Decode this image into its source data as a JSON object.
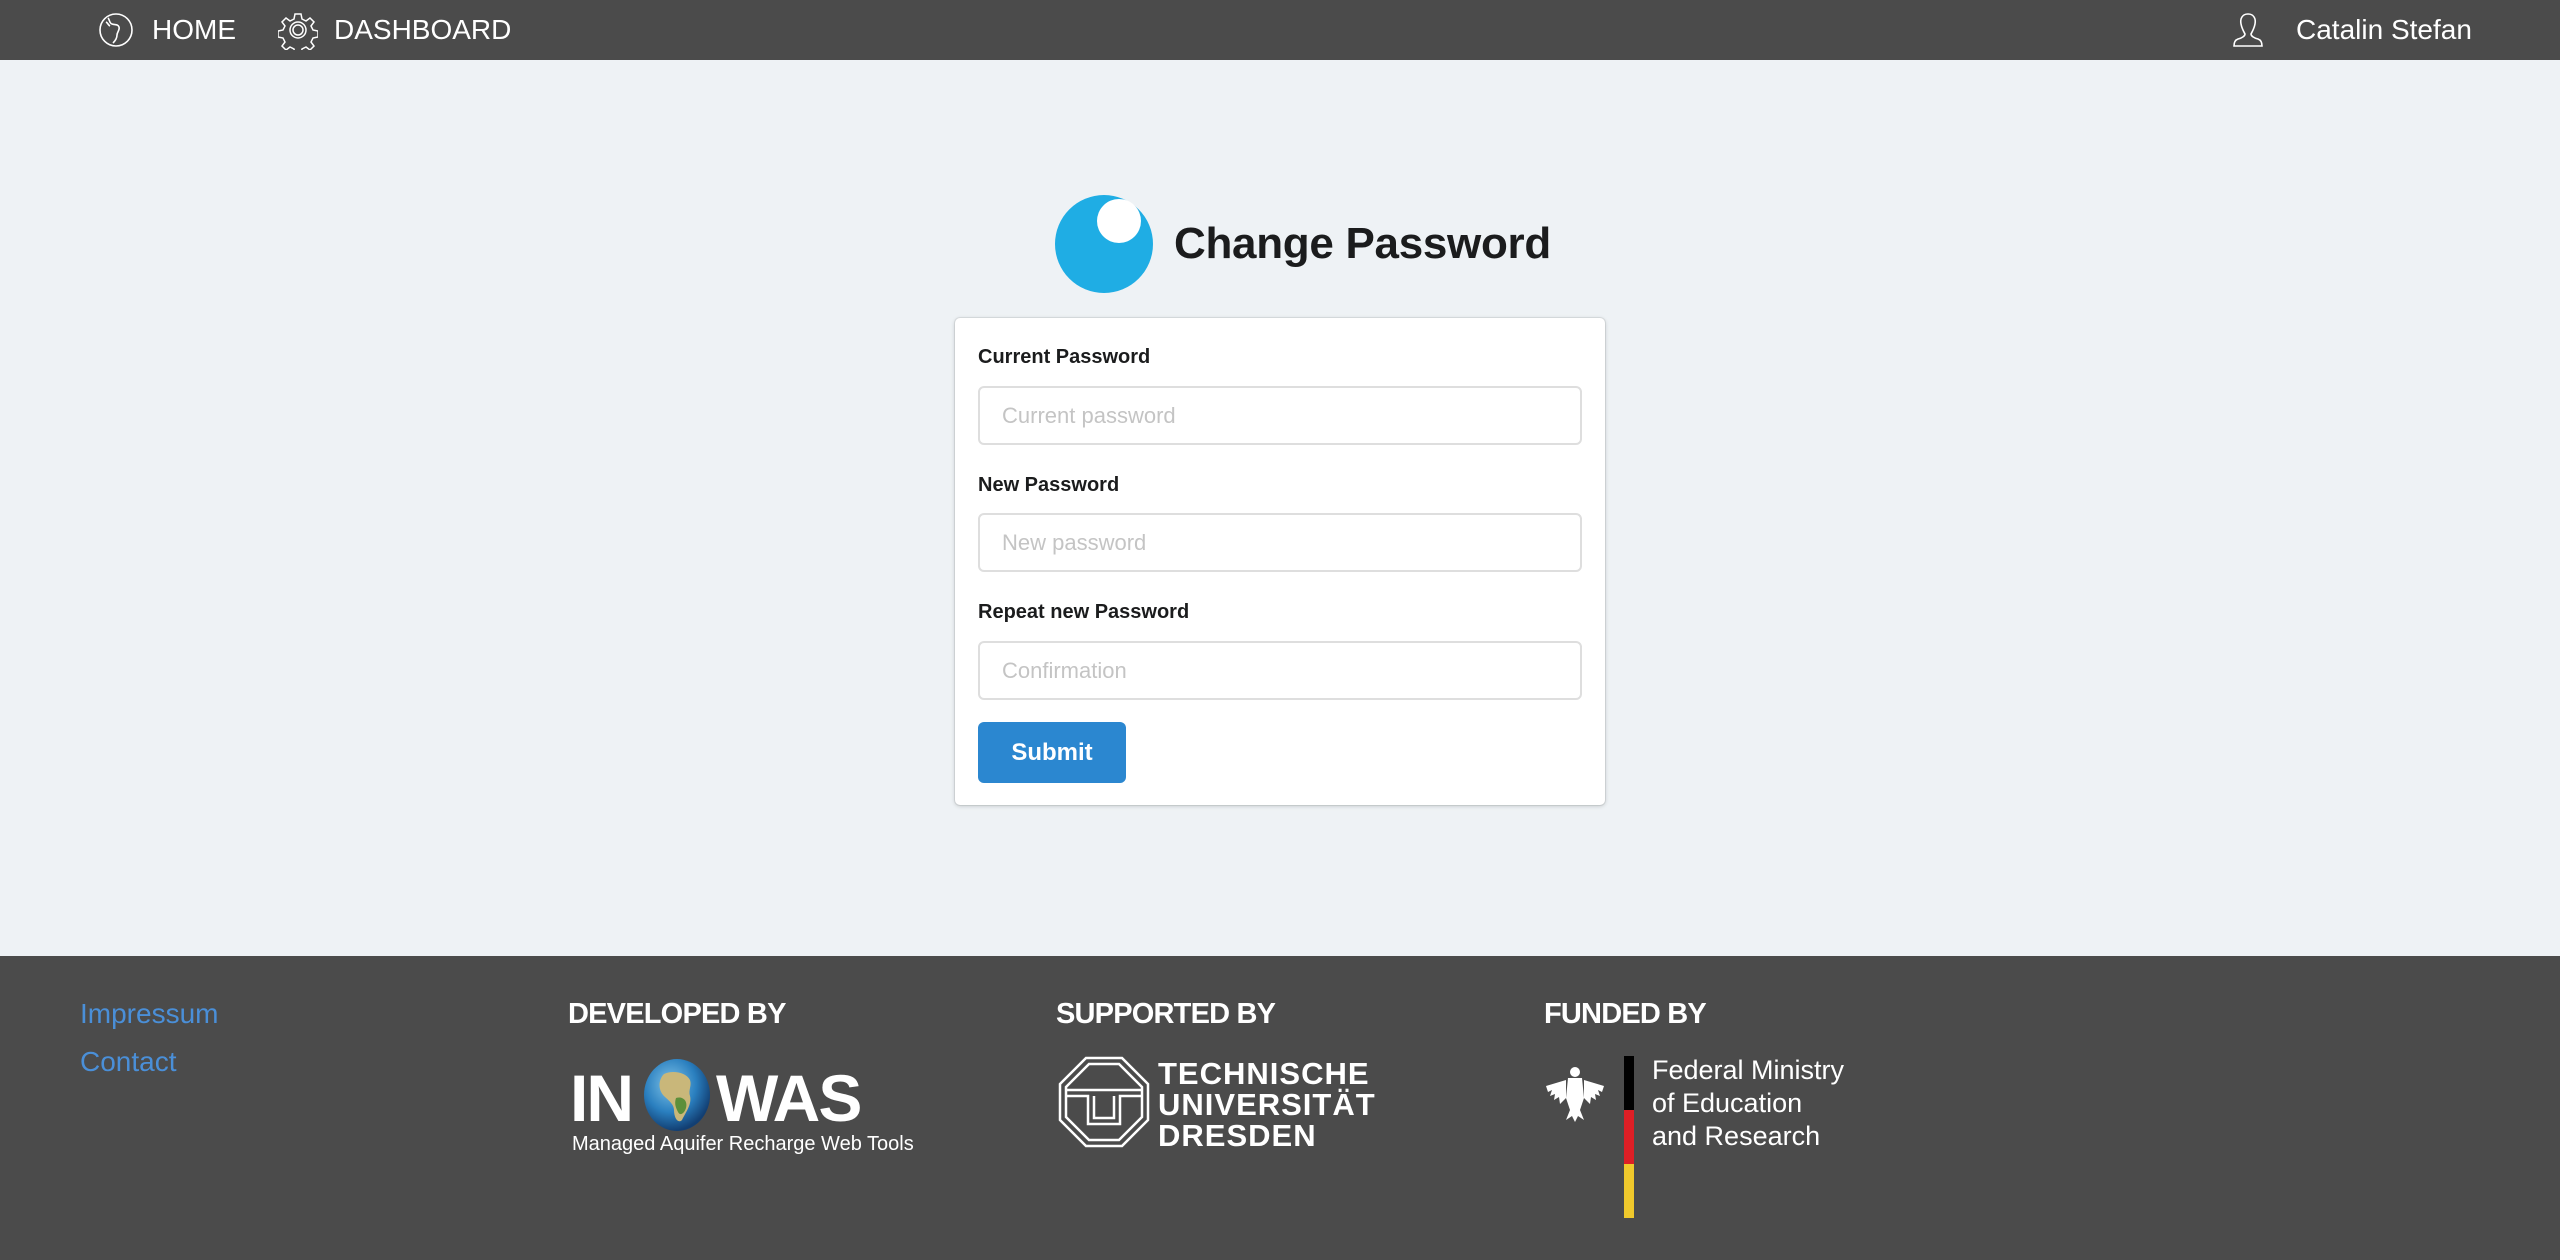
{
  "nav": {
    "home": {
      "label": "HOME",
      "icon": "globe-icon"
    },
    "dashboard": {
      "label": "DASHBOARD",
      "icon": "gear-icon"
    },
    "user": {
      "label": "Catalin Stefan",
      "icon": "user-icon"
    }
  },
  "header": {
    "title": "Change Password",
    "logo_color": "#1fade4"
  },
  "form": {
    "fields": [
      {
        "label": "Current Password",
        "placeholder": "Current password",
        "value": ""
      },
      {
        "label": "New Password",
        "placeholder": "New password",
        "value": ""
      },
      {
        "label": "Repeat new Password",
        "placeholder": "Confirmation",
        "value": ""
      }
    ],
    "submit_label": "Submit",
    "submit_color": "#2b87d0"
  },
  "footer": {
    "links": [
      "Impressum",
      "Contact"
    ],
    "developed_by": {
      "heading": "DEVELOPED BY",
      "logo_left": "IN",
      "logo_right": "WAS",
      "tagline": "Managed Aquifer Recharge Web Tools"
    },
    "supported_by": {
      "heading": "SUPPORTED BY",
      "lines": [
        "TECHNISCHE",
        "UNIVERSITÄT",
        "DRESDEN"
      ]
    },
    "funded_by": {
      "heading": "FUNDED BY",
      "lines": [
        "Federal Ministry",
        "of Education",
        "and Research"
      ],
      "flag_colors": [
        "#000000",
        "#dd1f26",
        "#f0c92c"
      ]
    }
  }
}
